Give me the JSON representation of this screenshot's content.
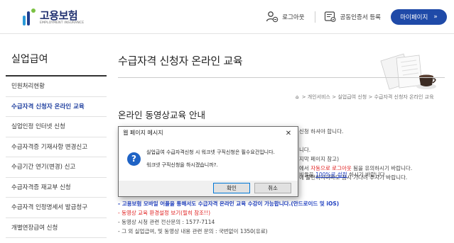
{
  "header": {
    "logo_name": "고용보험",
    "logo_sub": "EMPLOYMENT INSURANCE",
    "logout_label": "로그아웃",
    "cert_label": "공동인증서 등록",
    "mypage_label": "마이페이지",
    "mypage_chevron": "»"
  },
  "sidebar": {
    "title": "실업급여",
    "items": [
      {
        "label": "민원처리현황"
      },
      {
        "label": "수급자격 신청자 온라인 교육"
      },
      {
        "label": "실업인정 인터넷 신청"
      },
      {
        "label": "수급자격증 기재사항 변경신고"
      },
      {
        "label": "수급기간 연기(변경) 신고"
      },
      {
        "label": "수급자격증 재교부 신청"
      },
      {
        "label": "수급자격 인정명세서 발급청구"
      },
      {
        "label": "개별연장급여 신청"
      }
    ]
  },
  "main": {
    "title": "수급자격 신청자 온라인 교육",
    "breadcrumb": [
      "개인서비스",
      "실업급여 신청",
      "수급자격 신청자 온라인 교육"
    ],
    "breadcrumb_sep": ">",
    "section_title": "온라인 동영상교육 안내",
    "partial": {
      "l1": "신청 하셔야 합니다.",
      "l2": "니다.",
      "l3": "지막 페이지 참고)",
      "l4_pre": "에서 ",
      "l4_red": "자동으로 로그아웃",
      "l4_post": " 됨을 유의하시기 바랍니다.",
      "l5": "에 불편하시더라도 잠시 기다려 주시기 바랍니다.",
      "l6_pre": "비율을 ",
      "l6_u": "100%로 설정",
      "l6_post": " 하시기 바랍니다."
    },
    "notices": {
      "mobile": "- 고용보험 모바일 어플을 통해서도 수급자격 온라인 교육 수강이 가능합니다.(안드로이드 및 iOS)",
      "env": "- 동영상 교육 환경설정 보기(필히 참조!!)",
      "tech": "- 동영상 시청 관련 전산문의 : 1577-7114",
      "other": "- 그 외 실업급여, 및 동영상 내용 관련 문의 : 국번없이 1350(유료)"
    }
  },
  "dialog": {
    "title": "웹 페이지 메시지",
    "close": "✕",
    "icon": "?",
    "line1": "실업급여 수급자격신청 시 워크넷 구직신청은 필수요건입니다.",
    "line2": "워크넷 구직신청을 하시겠습니까?.",
    "ok_label": "확인",
    "cancel_label": "취소"
  },
  "icons": {
    "logout": "user-minus-icon",
    "cert": "certificate-icon",
    "home": "home-icon",
    "question": "question-icon"
  },
  "colors": {
    "brand_navy": "#1f2f6f",
    "mypage_button": "#1f4aa8",
    "active_menu": "#1f3f9f",
    "red_text": "#e02020",
    "blue_text": "#1f3fc0",
    "dialog_icon": "#1f63c5"
  }
}
